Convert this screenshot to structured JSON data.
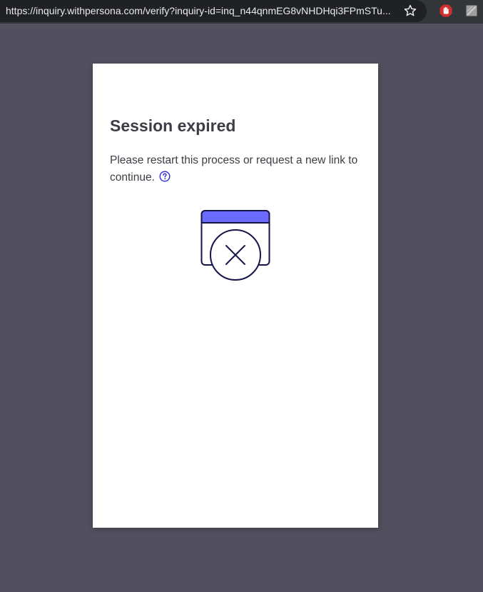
{
  "browser": {
    "url": "https://inquiry.withpersona.com/verify?inquiry-id=inq_n44qnmEG8vNHDHqi3FPmSTu...",
    "icons": [
      "star-icon",
      "stop-hand-extension-icon",
      "image-extension-icon"
    ]
  },
  "dialog": {
    "title": "Session expired",
    "message": "Please restart this process or request a new link to continue.",
    "help_icon": "question-circle-icon",
    "illustration": "expired-window-x-icon"
  },
  "colors": {
    "page_background": "#52505f",
    "card_background": "#ffffff",
    "accent": "#6b6cff",
    "icon_stroke": "#16154a",
    "text": "#3d3d46"
  }
}
